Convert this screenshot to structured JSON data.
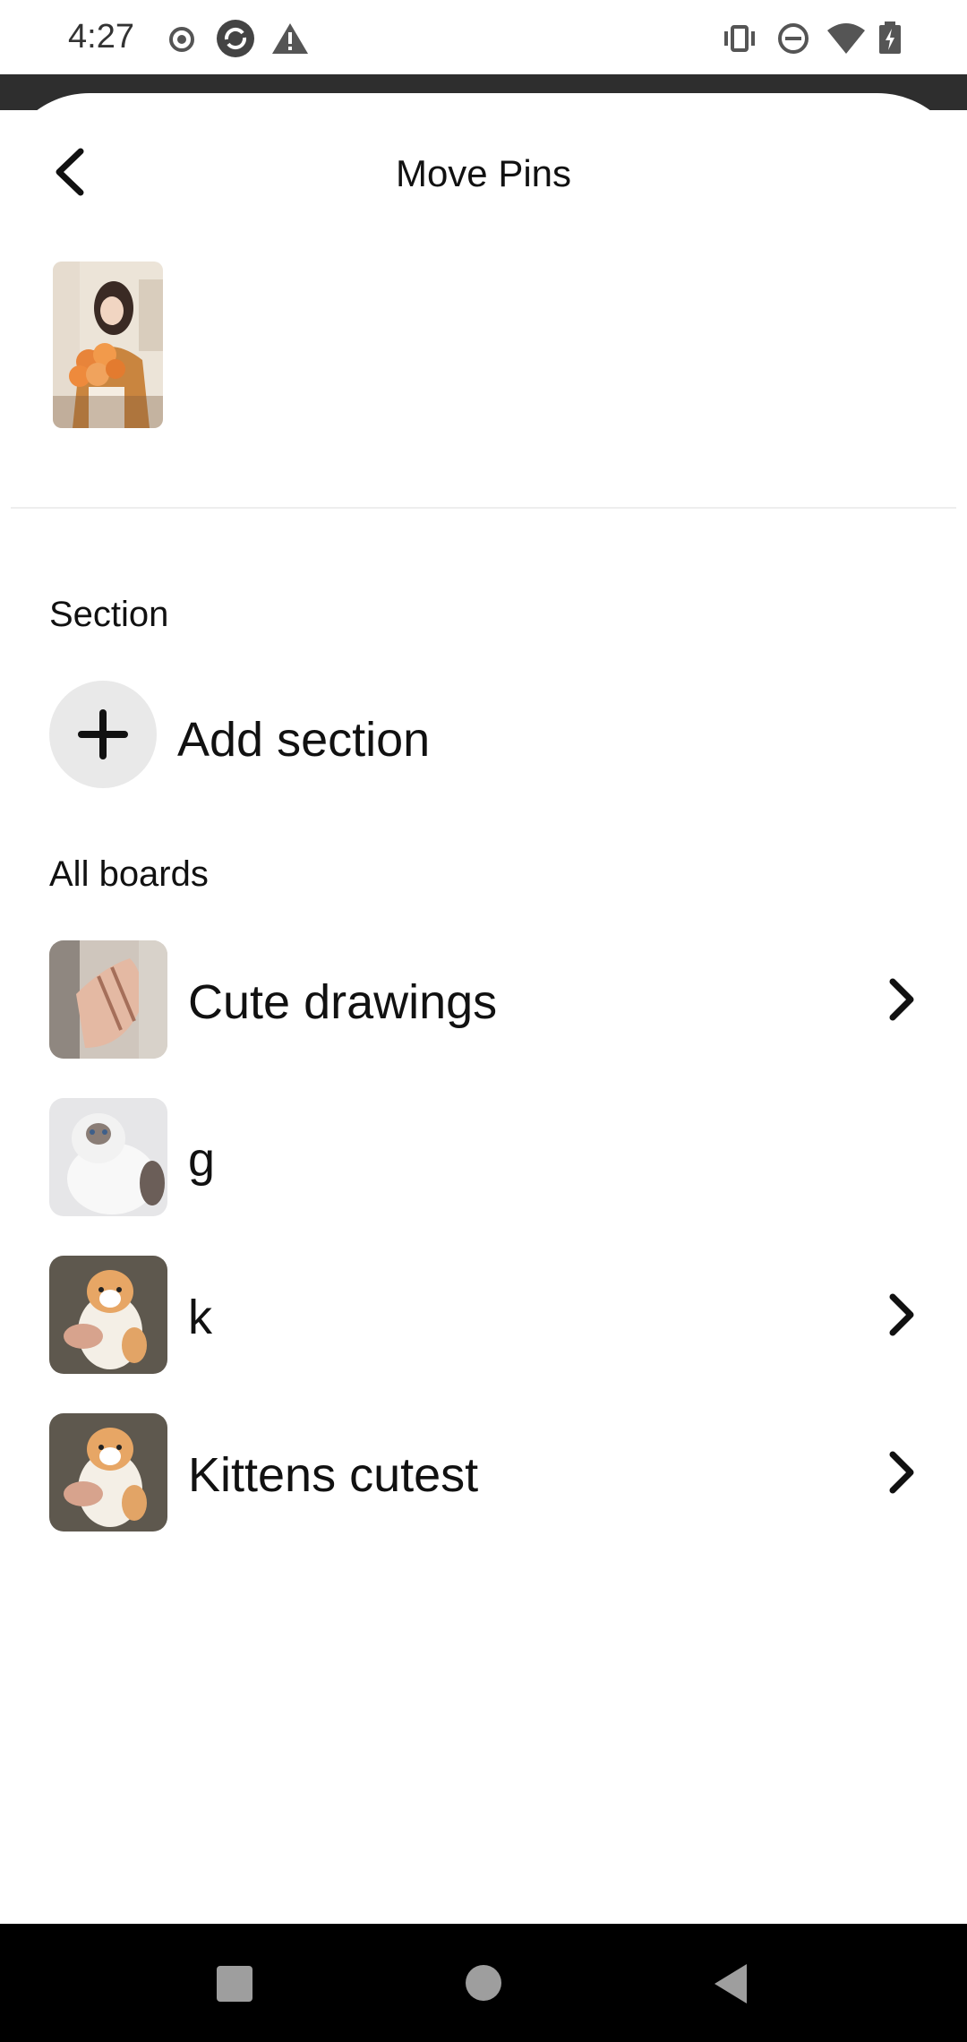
{
  "status_bar": {
    "time": "4:27",
    "left_icons": [
      "record-icon",
      "sync-icon",
      "warning-icon"
    ],
    "right_icons": [
      "vibrate-icon",
      "do-not-disturb-icon",
      "wifi-icon",
      "battery-charging-icon"
    ]
  },
  "header": {
    "title": "Move Pins",
    "back_icon": "chevron-left-icon"
  },
  "selected_pin": {
    "thumbnail": "pin-thumbnail-woman-with-flowers"
  },
  "section": {
    "heading": "Section",
    "add_label": "Add section",
    "add_icon": "plus-icon"
  },
  "boards": {
    "heading": "All boards",
    "items": [
      {
        "name": "Cute drawings",
        "thumbnail": "hands-drawing",
        "has_chevron": true
      },
      {
        "name": "g",
        "thumbnail": "cat-white-grey",
        "has_chevron": false
      },
      {
        "name": "k",
        "thumbnail": "kitten-held",
        "has_chevron": true
      },
      {
        "name": "Kittens cutest",
        "thumbnail": "kitten-held",
        "has_chevron": true
      }
    ]
  },
  "nav_bar": {
    "icons": [
      "recents-square-icon",
      "home-circle-icon",
      "back-triangle-icon"
    ]
  },
  "colors": {
    "background": "#ffffff",
    "text": "#111111",
    "add_circle": "#e9e9e9",
    "scrim": "#2e2e2e",
    "nav_bar": "#000000"
  }
}
